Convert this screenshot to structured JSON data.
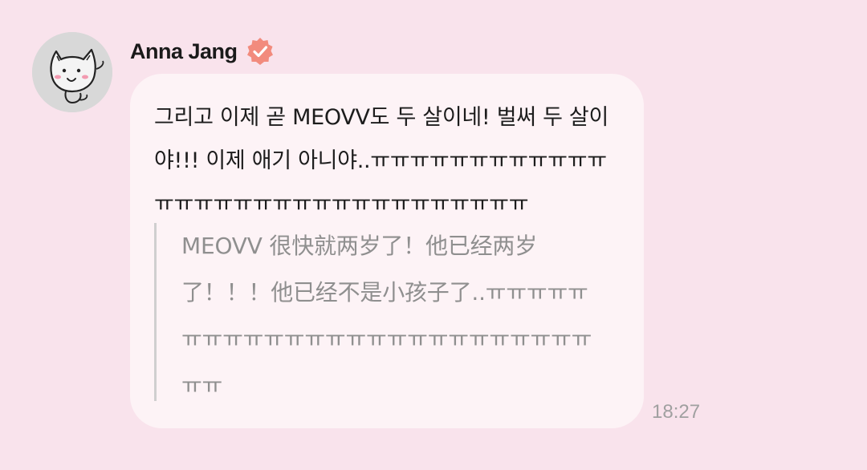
{
  "sender": {
    "name": "Anna Jang",
    "avatar_icon": "cat-doodle-avatar",
    "verified_icon": "verified-badge-icon",
    "verified_color": "#f28b7d"
  },
  "message": {
    "text": "그리고 이제 곧 MEOVV도 두 살이네! 벌써 두 살이야!!! 이제 애기 아니야..ㅠㅠㅠㅠㅠㅠㅠㅠㅠㅠㅠㅠㅠㅠㅠㅠㅠㅠㅠㅠㅠㅠㅠㅠㅠㅠㅠㅠㅠㅠㅠ",
    "translation": "MEOVV 很快就两岁了！他已经两岁了！！！他已经不是小孩子了..ㅠㅠㅠㅠㅠㅠㅠㅠㅠㅠㅠㅠㅠㅠㅠㅠㅠㅠㅠㅠㅠㅠㅠㅠㅠㅠㅠ",
    "time": "18:27"
  },
  "colors": {
    "background": "#f9e3ec",
    "bubble": "#fdf3f6",
    "text": "#1c1c1c",
    "translation_text": "#8f8f8f",
    "timestamp": "#a0a0a0"
  }
}
